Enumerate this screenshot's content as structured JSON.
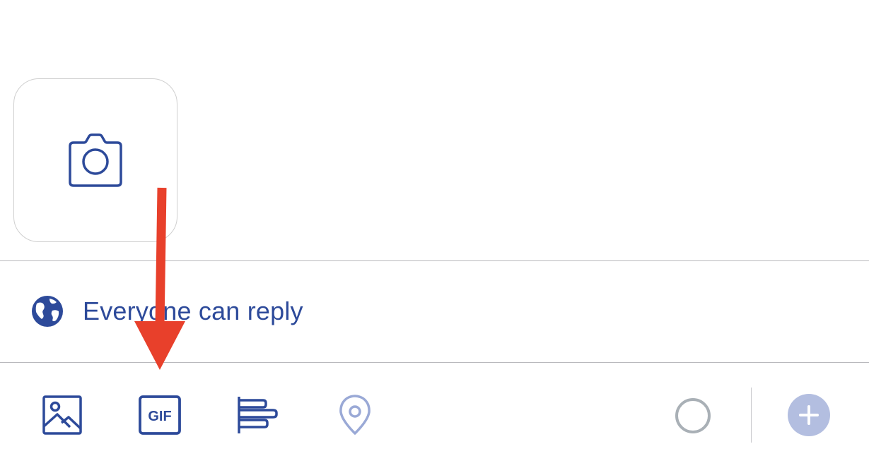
{
  "composer": {
    "camera_tile": {
      "icon": "camera-icon"
    },
    "reply_setting": {
      "icon": "globe-icon",
      "label": "Everyone can reply"
    },
    "toolbar": {
      "media_icon": "image-icon",
      "gif_icon": "gif-icon",
      "gif_label": "GIF",
      "poll_icon": "poll-icon",
      "location_icon": "location-pin-icon",
      "progress_icon": "character-counter-ring-icon",
      "add_icon": "plus-icon"
    }
  },
  "colors": {
    "accent": "#2d4a9a",
    "disabled_accent": "#9aa9d6",
    "add_button_bg": "#b3bee0",
    "counter_ring": "#a9b0b6",
    "annotation_arrow": "#e8402b"
  }
}
